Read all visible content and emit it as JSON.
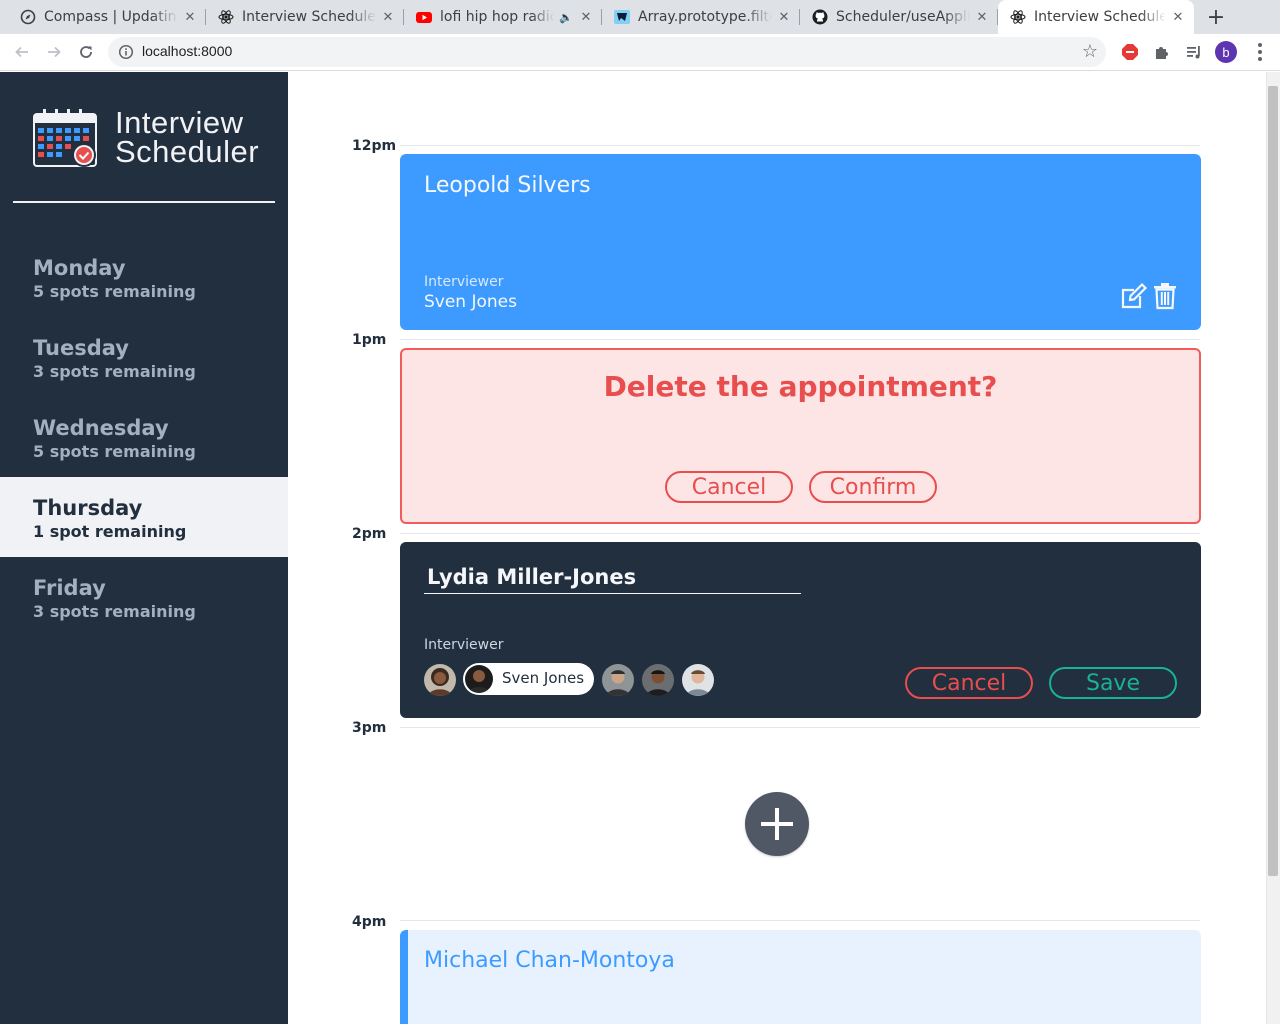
{
  "browser": {
    "tabs": [
      {
        "title": "Compass | Updating",
        "favicon": "compass-icon"
      },
      {
        "title": "Interview Scheduler",
        "favicon": "react-icon"
      },
      {
        "title": "lofi hip hop radio",
        "favicon": "youtube-icon"
      },
      {
        "title": "Array.prototype.filter",
        "favicon": "mdn-icon"
      },
      {
        "title": "Scheduler/useApplicationData",
        "favicon": "github-icon"
      },
      {
        "title": "Interview Scheduler",
        "favicon": "react-icon"
      }
    ],
    "url": "localhost:8000",
    "profile_initial": "b"
  },
  "sidebar": {
    "brand_line1": "Interview",
    "brand_line2": "Scheduler",
    "days": [
      {
        "name": "Monday",
        "spots": "5 spots remaining"
      },
      {
        "name": "Tuesday",
        "spots": "3 spots remaining"
      },
      {
        "name": "Wednesday",
        "spots": "5 spots remaining"
      },
      {
        "name": "Thursday",
        "spots": "1 spot remaining"
      },
      {
        "name": "Friday",
        "spots": "3 spots remaining"
      }
    ],
    "selected_day": "Thursday"
  },
  "schedule": {
    "times": [
      "12pm",
      "1pm",
      "2pm",
      "3pm",
      "4pm"
    ],
    "appointment_show": {
      "student": "Leopold Silvers",
      "interviewer_label": "Interviewer",
      "interviewer": "Sven Jones"
    },
    "appointment_confirm": {
      "message": "Delete the appointment?",
      "cancel_label": "Cancel",
      "confirm_label": "Confirm"
    },
    "appointment_form": {
      "student": "Lydia Miller-Jones",
      "interviewer_label": "Interviewer",
      "selected_interviewer": "Sven Jones",
      "cancel_label": "Cancel",
      "save_label": "Save"
    },
    "appointment_next": {
      "student": "Michael Chan-Montoya"
    }
  },
  "colors": {
    "sidebar_bg": "#222f3e",
    "show_bg": "#3d9bff",
    "danger": "#e84e4e",
    "confirm_bg": "#fde5e6",
    "success": "#18b394"
  }
}
